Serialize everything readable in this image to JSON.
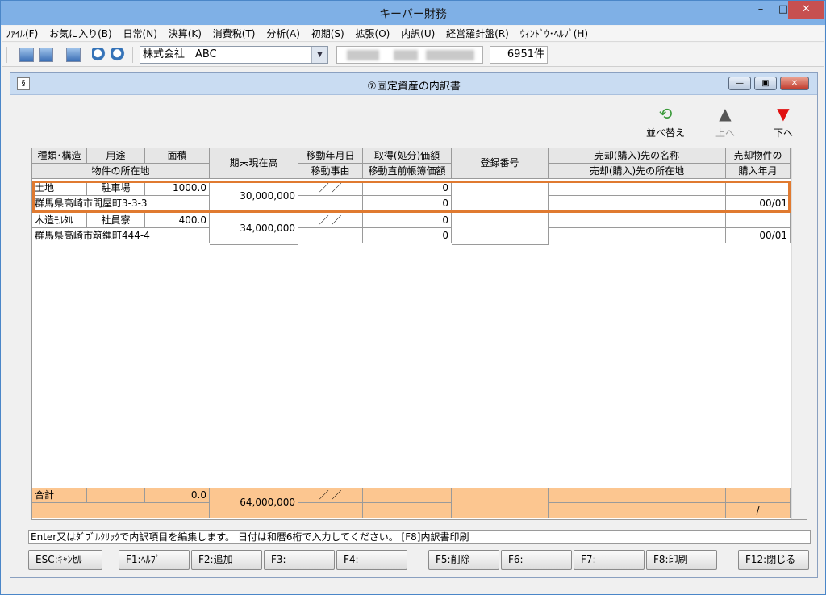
{
  "window": {
    "title": "キーパー財務",
    "min": "–",
    "max": "□",
    "close": "✕"
  },
  "menu": [
    "ﾌｧｲﾙ(F)",
    "お気に入り(B)",
    "日常(N)",
    "決算(K)",
    "消費税(T)",
    "分析(A)",
    "初期(S)",
    "拡張(O)",
    "内訳(U)",
    "経営羅針盤(R)",
    "ｳｨﾝﾄﾞｳ･ﾍﾙﾌﾟ(H)"
  ],
  "toolbar": {
    "company": "株式会社　ABC",
    "record_count": "6951件"
  },
  "child": {
    "title": "⑦固定資産の内訳書",
    "sort_label": "並べ替え",
    "up_label": "上へ",
    "down_label": "下へ"
  },
  "table": {
    "headers": {
      "type": "種類･構造",
      "use": "用途",
      "area": "面積",
      "location": "物件の所在地",
      "balance": "期末現在高",
      "move_date": "移動年月日",
      "move_reason": "移動事由",
      "acq_price": "取得(処分)価額",
      "book_value": "移動直前帳簿価額",
      "reg_no": "登録番号",
      "buyer_name": "売却(購入)先の名称",
      "buyer_addr": "売却(購入)先の所在地",
      "sold_item": "売却物件の",
      "buy_ym": "購入年月"
    },
    "rows": [
      {
        "type": "土地",
        "use": "駐車場",
        "area": "1000.0",
        "location": "群馬県高崎市問屋町3-3-3",
        "balance": "30,000,000",
        "move_date": "／ ／",
        "acq_price": "0",
        "book_value": "0",
        "buy_ym": "00/01"
      },
      {
        "type": "木造ﾓﾙﾀﾙ",
        "use": "社員寮",
        "area": "400.0",
        "location": "群馬県高崎市筑縄町444-4",
        "balance": "34,000,000",
        "move_date": "／ ／",
        "acq_price": "0",
        "book_value": "0",
        "buy_ym": "00/01"
      }
    ],
    "footer": {
      "label": "合計",
      "area": "0.0",
      "balance": "64,000,000",
      "move_date": "／ ／",
      "buy_ym": "/"
    }
  },
  "status_text": "Enter又はﾀﾞﾌﾞﾙｸﾘｯｸで内訳項目を編集します。 日付は和暦6桁で入力してください。 [F8]内訳書印刷",
  "fkeys": [
    "ESC:ｷｬﾝｾﾙ",
    "F1:ﾍﾙﾌﾟ",
    "F2:追加",
    "F3:",
    "F4:",
    "F5:削除",
    "F6:",
    "F7:",
    "F8:印刷",
    "F12:閉じる"
  ],
  "colors": {
    "selection": "#e07a30",
    "footer_bg": "#fcc690",
    "title_bg": "#7fb0e6"
  }
}
